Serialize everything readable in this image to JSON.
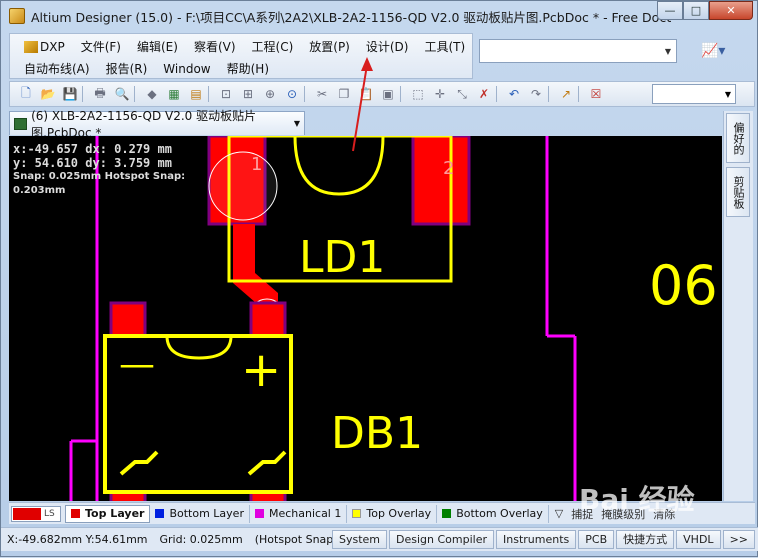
{
  "window": {
    "title": "Altium Designer (15.0) - F:\\项目CC\\A系列\\2A2\\XLB-2A2-1156-QD V2.0 驱动板贴片图.PcbDoc * - Free Docu...",
    "min_label": "—",
    "max_label": "□",
    "close_label": "✕"
  },
  "menu": {
    "row1": [
      "DXP",
      "文件(F)",
      "编辑(E)",
      "察看(V)",
      "工程(C)",
      "放置(P)",
      "设计(D)",
      "工具(T)"
    ],
    "row2": [
      "自动布线(A)",
      "报告(R)",
      "Window",
      "帮助(H)"
    ]
  },
  "combo": {
    "value": ""
  },
  "toolbar": {
    "icons": [
      "new-doc-icon",
      "open-folder-icon",
      "save-icon",
      "print-icon",
      "print-preview-icon",
      "3d-layers-icon",
      "board-icon",
      "component-icon",
      "zoom-fit-icon",
      "zoom-area-icon",
      "zoom-select-icon",
      "zoom-filter-icon",
      "cut-icon",
      "copy-icon",
      "paste-icon",
      "rubber-stamp-icon",
      "select-rect-icon",
      "move-icon",
      "deselect-icon",
      "clear-icon",
      "undo-icon",
      "redo-icon",
      "cross-probe-icon",
      "reset-error-icon"
    ]
  },
  "document_tab": {
    "label": "(6) XLB-2A2-1156-QD V2.0 驱动板贴片图.PcbDoc *"
  },
  "side_tabs": [
    "偏好的",
    "剪贴板"
  ],
  "hud": {
    "line1": "x:-49.657   dx:  0.279 mm",
    "line2": "y: 54.610   dy:  3.759 mm",
    "line3": "Snap: 0.025mm Hotspot Snap: 0.203mm"
  },
  "pcb": {
    "labels": {
      "ld1": "LD1",
      "db1": "DB1",
      "partial": "06",
      "pin1": "1",
      "pin2": "2",
      "minus": "—",
      "plus": "+"
    },
    "colors": {
      "background": "#000000",
      "top_layer": "#ff0000",
      "overlay": "#ffff00",
      "mechanical": "#ff00ff",
      "pad_border": "#800080"
    }
  },
  "layerbar": {
    "ls_label": "LS",
    "layers": [
      {
        "name": "Top Layer",
        "color": "#e00000",
        "active": true
      },
      {
        "name": "Bottom Layer",
        "color": "#0020e0",
        "active": false
      },
      {
        "name": "Mechanical 1",
        "color": "#e000e0",
        "active": false
      },
      {
        "name": "Top Overlay",
        "color": "#ffff00",
        "active": false
      },
      {
        "name": "Bottom Overlay",
        "color": "#008000",
        "active": false
      }
    ],
    "extra": [
      "捕捉",
      "掩膜级别",
      "清除"
    ]
  },
  "status": {
    "coords": "X:-49.682mm Y:54.61mm",
    "grid": "Grid: 0.025mm",
    "snap": "(Hotspot Snap)",
    "buttons": [
      "System",
      "Design Compiler",
      "Instruments",
      "PCB",
      "快捷方式",
      "VHDL",
      ">>"
    ]
  },
  "watermark": {
    "text": "Bai 经验"
  }
}
